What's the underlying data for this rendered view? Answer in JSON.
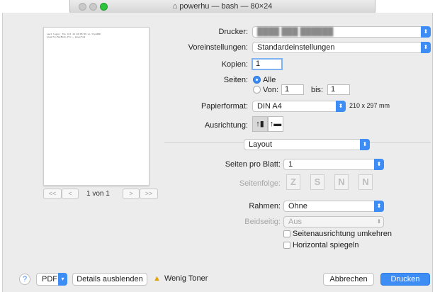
{
  "window": {
    "title": "powerhu — bash — 80×24"
  },
  "preview": {
    "page_text": "Last login: Thu Oct 19 10:05:59 on ttys000\npowerhu-MacBook-Pro:~ powerhu$",
    "page_label": "1 von 1",
    "first_label": "<<",
    "prev_label": "<",
    "next_label": ">",
    "last_label": ">>"
  },
  "printer": {
    "label": "Drucker:",
    "value": "████ ███ ██████"
  },
  "presets": {
    "label": "Voreinstellungen:",
    "value": "Standardeinstellungen"
  },
  "copies": {
    "label": "Kopien:",
    "value": "1"
  },
  "pages": {
    "label": "Seiten:",
    "all_label": "Alle",
    "from_label": "Von:",
    "from_value": "1",
    "to_label": "bis:",
    "to_value": "1"
  },
  "paper": {
    "label": "Papierformat:",
    "value": "DIN A4",
    "size_text": "210 x 297 mm"
  },
  "orientation": {
    "label": "Ausrichtung:",
    "portrait_icon": "portrait-icon",
    "landscape_icon": "landscape-icon"
  },
  "section": {
    "value": "Layout"
  },
  "layout": {
    "pages_per_sheet_label": "Seiten pro Blatt:",
    "pages_per_sheet_value": "1",
    "order_label": "Seitenfolge:",
    "order_glyphs": [
      "Z",
      "S",
      "N",
      "N"
    ],
    "border_label": "Rahmen:",
    "border_value": "Ohne",
    "duplex_label": "Beidseitig:",
    "duplex_value": "Aus",
    "reverse_label": "Seitenausrichtung umkehren",
    "flip_label": "Horizontal spiegeln"
  },
  "footer": {
    "help_label": "?",
    "pdf_label": "PDF",
    "details_label": "Details ausblenden",
    "toner_label": "Wenig Toner",
    "cancel_label": "Abbrechen",
    "print_label": "Drucken"
  },
  "colors": {
    "accent": "#3d8df5",
    "warning": "#e3a300"
  }
}
